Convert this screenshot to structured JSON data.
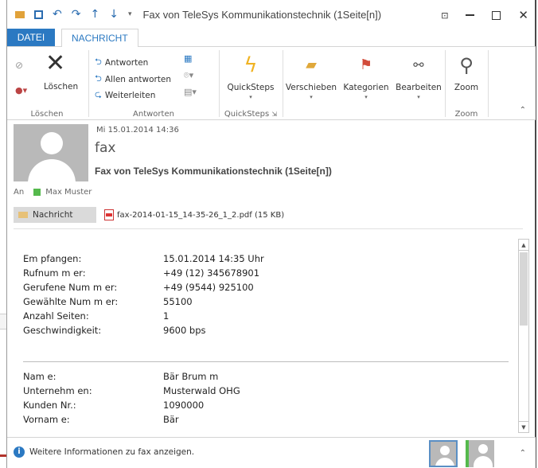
{
  "window": {
    "title": "Fax von TeleSys Kommunikationstechnik  (1Seite[n])"
  },
  "tabs": {
    "file": "DATEI",
    "message": "NACHRICHT"
  },
  "ribbon": {
    "loeschen_group": {
      "delete_label": "Löschen",
      "group_label": "Löschen"
    },
    "antworten_group": {
      "reply": "Antworten",
      "reply_all": "Allen antworten",
      "forward": "Weiterleiten",
      "group_label": "Antworten"
    },
    "quicksteps_group": {
      "label": "QuickSteps",
      "group_label": "QuickSteps"
    },
    "verschieben": "Verschieben",
    "kategorien": "Kategorien",
    "bearbeiten": "Bearbeiten",
    "zoom_group": {
      "label": "Zoom",
      "group_label": "Zoom"
    }
  },
  "header": {
    "date": "Mi 15.01.2014 14:36",
    "sender": "fax",
    "subject": "Fax von TeleSys Kommunikationstechnik  (1Seite[n])",
    "to_label": "An",
    "recipient": "Max Muster"
  },
  "attachments": {
    "message_tab": "Nachricht",
    "file": "fax-2014-01-15_14-35-26_1_2.pdf (15 KB)"
  },
  "body": {
    "fax_info": [
      {
        "key": "Em pfangen:",
        "value": "15.01.2014 14:35 Uhr"
      },
      {
        "key": "Rufnum m er:",
        "value": "+49 (12) 345678901"
      },
      {
        "key": "Gerufene Num m er:",
        "value": "+49 (9544) 925100"
      },
      {
        "key": "Gewählte Num m er:",
        "value": "55100"
      },
      {
        "key": "Anzahl Seiten:",
        "value": "1"
      },
      {
        "key": "Geschwindigkeit:",
        "value": "9600 bps"
      }
    ],
    "contact_info": [
      {
        "key": "Nam e:",
        "value": "Bär Brum m"
      },
      {
        "key": "Unternehm en:",
        "value": "Musterwald OHG"
      },
      {
        "key": "Kunden Nr.:",
        "value": "1090000"
      },
      {
        "key": "Vornam e:",
        "value": "Bär"
      }
    ]
  },
  "footer": {
    "info_text": "Weitere Informationen zu fax anzeigen."
  },
  "colors": {
    "accent": "#2b79c2",
    "presence_green": "#55b94c"
  }
}
